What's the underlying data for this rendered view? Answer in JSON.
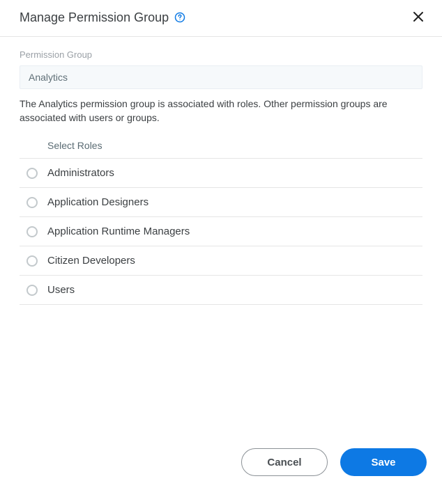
{
  "header": {
    "title": "Manage Permission Group"
  },
  "form": {
    "permission_group_label": "Permission Group",
    "permission_group_value": "Analytics",
    "description": "The Analytics permission group is associated with roles. Other permission groups are associated with users or groups.",
    "select_roles_label": "Select Roles"
  },
  "roles": [
    {
      "label": "Administrators"
    },
    {
      "label": "Application Designers"
    },
    {
      "label": "Application Runtime Managers"
    },
    {
      "label": "Citizen Developers"
    },
    {
      "label": "Users"
    }
  ],
  "footer": {
    "cancel_label": "Cancel",
    "save_label": "Save"
  }
}
